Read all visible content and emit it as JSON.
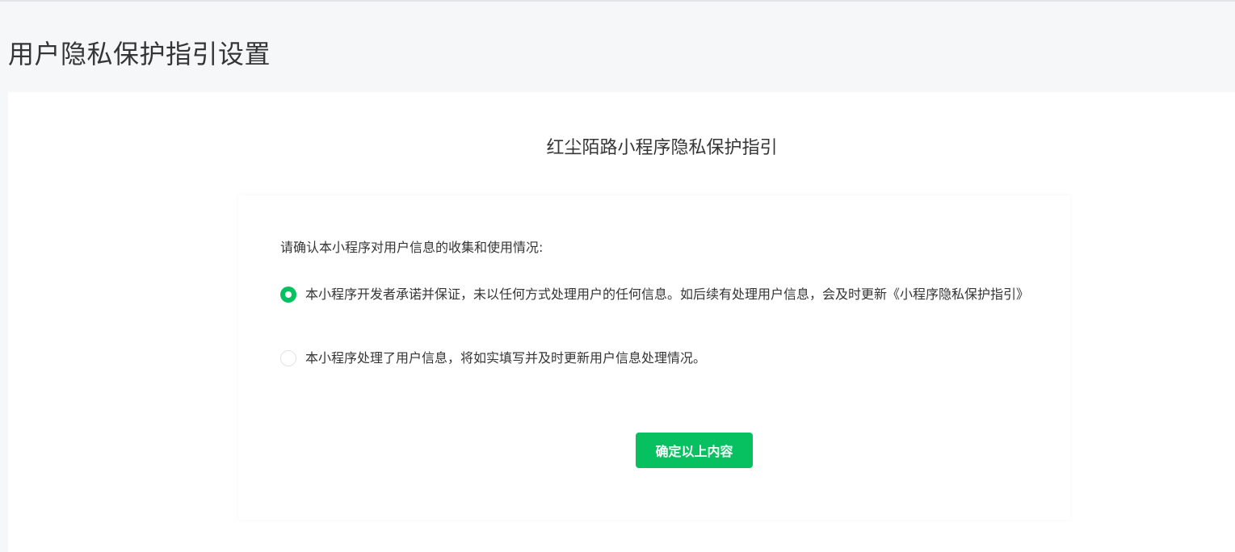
{
  "page": {
    "title": "用户隐私保护指引设置"
  },
  "guide": {
    "title": "红尘陌路小程序隐私保护指引",
    "prompt": "请确认本小程序对用户信息的收集和使用情况:",
    "options": [
      {
        "label": "本小程序开发者承诺并保证，未以任何方式处理用户的任何信息。如后续有处理用户信息，会及时更新《小程序隐私保护指引》",
        "selected": true
      },
      {
        "label": "本小程序处理了用户信息，将如实填写并及时更新用户信息处理情况。",
        "selected": false
      }
    ],
    "confirm_label": "确定以上内容"
  },
  "colors": {
    "accent": "#07c160",
    "page_background": "#f6f7f9",
    "card_background": "#ffffff",
    "text": "#353535"
  }
}
